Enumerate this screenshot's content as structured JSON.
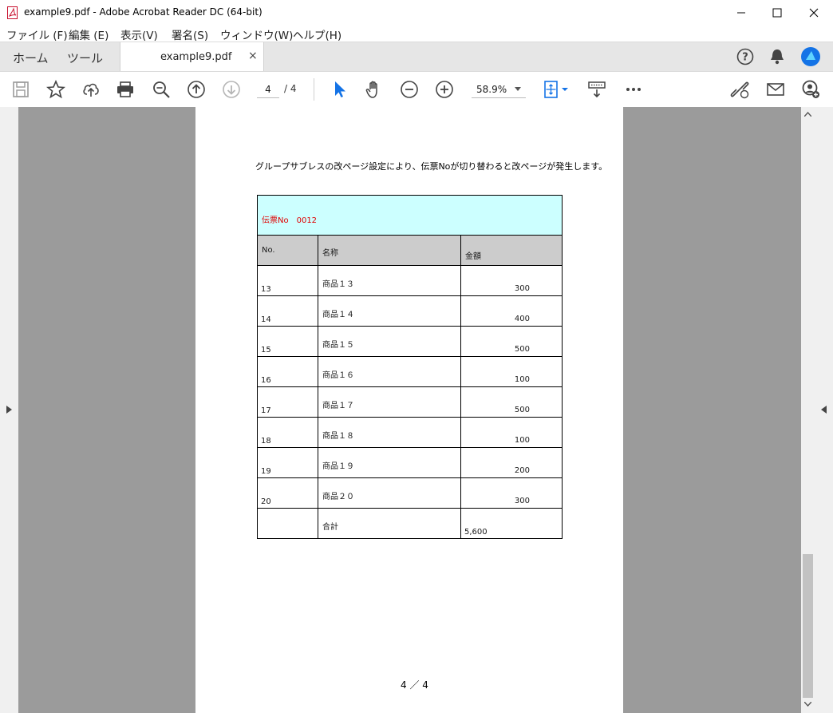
{
  "window": {
    "title": "example9.pdf - Adobe Acrobat Reader DC (64-bit)",
    "minimize_icon": "minimize-icon",
    "maximize_icon": "maximize-icon",
    "close_icon": "close-icon"
  },
  "menu": [
    "ファイル (F)",
    "編集 (E)",
    "表示(V)",
    "署名(S)",
    "ウィンドウ(W)",
    "ヘルプ(H)"
  ],
  "tabs": {
    "home": "ホーム",
    "tools": "ツール",
    "document": "example9.pdf",
    "close_glyph": "×"
  },
  "toolbar": {
    "page_current": "4",
    "page_total": "/ 4",
    "zoom": "58.9%"
  },
  "document": {
    "intro": "グループサブレスの改ページ設定により、伝票Noが切り替わると改ページが発生します。",
    "slip": "伝票No　0012",
    "columns": [
      "No.",
      "名称",
      "金額"
    ],
    "rows": [
      {
        "no": "13",
        "name": "商品１３",
        "amount": "300"
      },
      {
        "no": "14",
        "name": "商品１４",
        "amount": "400"
      },
      {
        "no": "15",
        "name": "商品１５",
        "amount": "500"
      },
      {
        "no": "16",
        "name": "商品１６",
        "amount": "100"
      },
      {
        "no": "17",
        "name": "商品１７",
        "amount": "500"
      },
      {
        "no": "18",
        "name": "商品１８",
        "amount": "100"
      },
      {
        "no": "19",
        "name": "商品１９",
        "amount": "200"
      },
      {
        "no": "20",
        "name": "商品２０",
        "amount": "300"
      }
    ],
    "total_label": "合計",
    "total_value": "5,600",
    "footer": "4 ／ 4"
  },
  "colors": {
    "accent": "#1473e6",
    "slip_bg": "#ccffff",
    "slip_text": "#e00000",
    "header_bg": "#cccccc"
  }
}
